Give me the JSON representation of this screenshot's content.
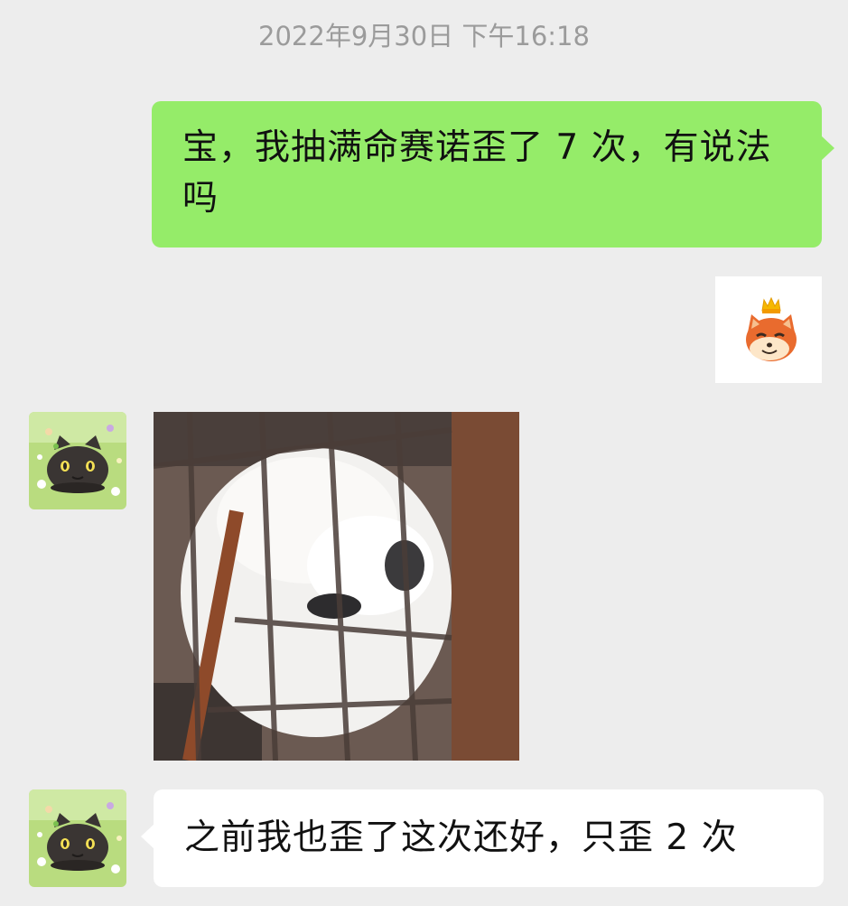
{
  "timestamp": "2022年9月30日 下午16:18",
  "messages": [
    {
      "side": "out",
      "type": "text",
      "text": "宝，我抽满命赛诺歪了 7 次，有说法吗"
    },
    {
      "side": "out",
      "type": "sticker",
      "icon": "fox-with-crown-sticker"
    },
    {
      "side": "in",
      "type": "image",
      "icon": "white-dog-in-cage-photo"
    },
    {
      "side": "in",
      "type": "text",
      "text": "之前我也歪了这次还好，只歪 2 次"
    }
  ],
  "colors": {
    "background": "#ededed",
    "outgoing_bubble": "#95ec69",
    "incoming_bubble": "#ffffff",
    "timestamp_text": "#9b9b9b"
  }
}
